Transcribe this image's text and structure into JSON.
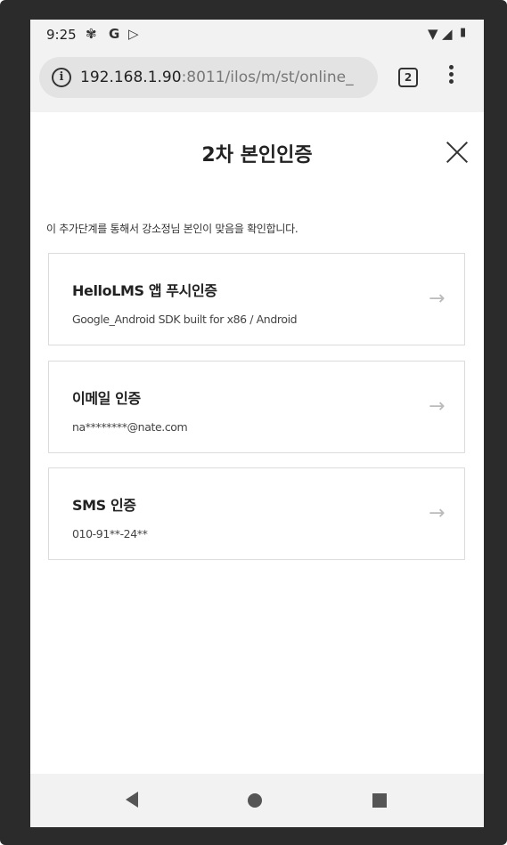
{
  "status_bar": {
    "time": "9:25",
    "icons": [
      "fan-icon",
      "google-icon",
      "play-store-icon",
      "wifi-icon",
      "signal-icon",
      "battery-icon"
    ]
  },
  "browser": {
    "info_glyph": "i",
    "url_host": "192.168.1.90",
    "url_rest": ":8011/ilos/m/st/online_",
    "tab_count": "2"
  },
  "page": {
    "title": "2차 본인인증",
    "description": "이 추가단계를 통해서 강소정님 본인이 맞음을 확인합니다.",
    "methods": [
      {
        "title": "HelloLMS 앱 푸시인증",
        "detail": "Google_Android SDK built for x86 / Android",
        "arrow": "→"
      },
      {
        "title": "이메일 인증",
        "detail": "na********@nate.com",
        "arrow": "→"
      },
      {
        "title": "SMS 인증",
        "detail": "010-91**-24**",
        "arrow": "→"
      }
    ]
  },
  "icons": {
    "close": "close-icon",
    "back": "back-icon",
    "home": "home-icon",
    "recent": "recent-apps-icon"
  }
}
